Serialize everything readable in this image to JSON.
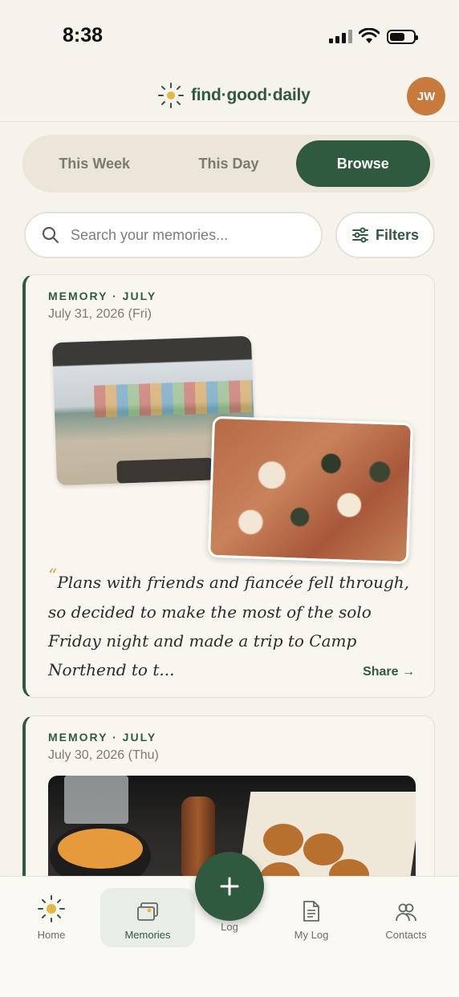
{
  "status_bar": {
    "time": "8:38"
  },
  "header": {
    "brand": "find·good·daily",
    "avatar_initials": "JW"
  },
  "segments": [
    {
      "label": "This Week",
      "active": false
    },
    {
      "label": "This Day",
      "active": false
    },
    {
      "label": "Browse",
      "active": true
    }
  ],
  "search": {
    "placeholder": "Search your memories..."
  },
  "filters": {
    "label": "Filters"
  },
  "memories": [
    {
      "kicker": "MEMORY · JULY",
      "date": "July 31, 2026 (Fri)",
      "quote": "Plans with friends and fiancée fell through, so decided to make the most of the solo Friday night and made a trip to Camp Northend to t...",
      "share_label": "Share →"
    },
    {
      "kicker": "MEMORY · JULY",
      "date": "July 30, 2026 (Thu)"
    }
  ],
  "bottom_nav": [
    {
      "label": "Home",
      "icon": "sun-icon"
    },
    {
      "label": "Memories",
      "icon": "memories-icon",
      "active": true
    },
    {
      "label": "Log",
      "icon": "plus-icon"
    },
    {
      "label": "My Log",
      "icon": "document-icon"
    },
    {
      "label": "Contacts",
      "icon": "contacts-icon"
    }
  ],
  "colors": {
    "primary": "#2f5a3f",
    "accent": "#c87a3d",
    "sun": "#e2b743",
    "background": "#f6f3ec"
  }
}
